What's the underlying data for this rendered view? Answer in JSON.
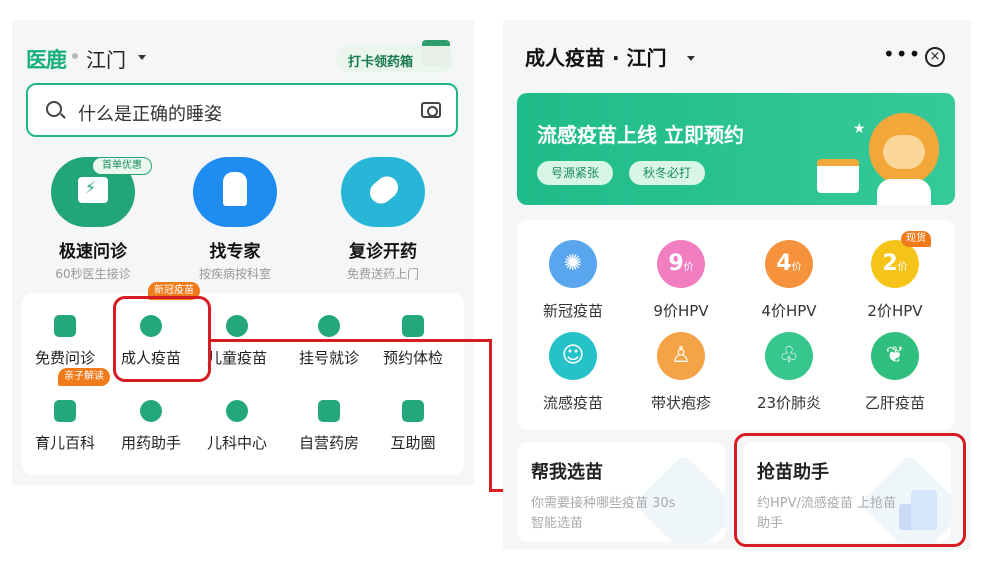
{
  "left": {
    "logo": "医鹿",
    "city": "江门",
    "checkin_label": "打卡领药箱",
    "search_placeholder": "什么是正确的睡姿",
    "first_badge": "首单优惠",
    "services": [
      {
        "title": "极速问诊",
        "sub": "60秒医生接诊"
      },
      {
        "title": "找专家",
        "sub": "按疾病按科室"
      },
      {
        "title": "复诊开药",
        "sub": "免费送药上门"
      }
    ],
    "grid": [
      "免费问诊",
      "成人疫苗",
      "儿童疫苗",
      "挂号就诊",
      "预约体检",
      "育儿百科",
      "用药助手",
      "儿科中心",
      "自营药房",
      "互助圈"
    ],
    "tag_new": "新冠疫苗",
    "tag_parent": "亲子解读"
  },
  "right": {
    "title": "成人疫苗 · 江门",
    "more": "•••",
    "close": "×",
    "banner": {
      "title": "流感疫苗上线  立即预约",
      "chip1": "号源紧张",
      "chip2": "秋冬必打"
    },
    "tag_stock": "现货",
    "vaccines": [
      {
        "label": "新冠疫苗",
        "mark": "",
        "unit": ""
      },
      {
        "label": "9价HPV",
        "mark": "9",
        "unit": "价"
      },
      {
        "label": "4价HPV",
        "mark": "4",
        "unit": "价"
      },
      {
        "label": "2价HPV",
        "mark": "2",
        "unit": "价"
      },
      {
        "label": "流感疫苗",
        "mark": "",
        "unit": ""
      },
      {
        "label": "带状疱疹",
        "mark": "",
        "unit": ""
      },
      {
        "label": "23价肺炎",
        "mark": "",
        "unit": ""
      },
      {
        "label": "乙肝疫苗",
        "mark": "",
        "unit": ""
      }
    ],
    "cards": [
      {
        "title": "帮我选苗",
        "sub": "你需要接种哪些疫苗 30s智能选苗"
      },
      {
        "title": "抢苗助手",
        "sub": "约HPV/流感疫苗 上抢苗助手"
      }
    ]
  }
}
